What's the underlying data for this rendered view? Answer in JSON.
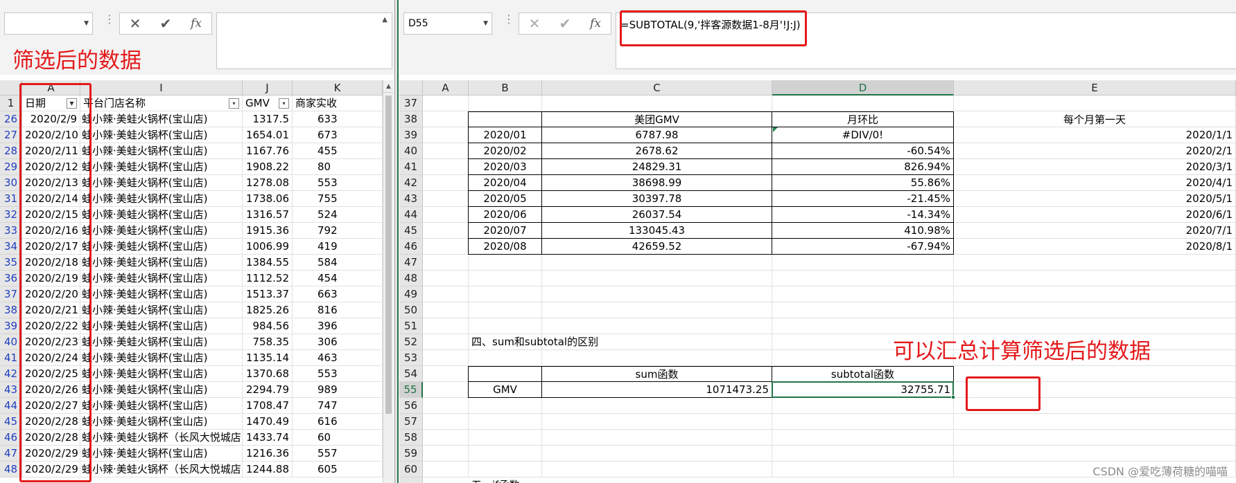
{
  "left": {
    "namebox": "",
    "formula": "",
    "col_headers": [
      "A",
      "I",
      "J",
      "K"
    ],
    "header_row": {
      "row": "1",
      "date": "日期",
      "store": "平台门店名称",
      "gmv": "GMV",
      "merchant": "商家实收"
    },
    "rows": [
      {
        "row": "26",
        "date": "2020/2/9",
        "store": "蛙小辣·美蛙火锅杯(宝山店)",
        "gmv": "1317.5",
        "k": "633"
      },
      {
        "row": "27",
        "date": "2020/2/10",
        "store": "蛙小辣·美蛙火锅杯(宝山店)",
        "gmv": "1654.01",
        "k": "673"
      },
      {
        "row": "28",
        "date": "2020/2/11",
        "store": "蛙小辣·美蛙火锅杯(宝山店)",
        "gmv": "1167.76",
        "k": "455"
      },
      {
        "row": "29",
        "date": "2020/2/12",
        "store": "蛙小辣·美蛙火锅杯(宝山店)",
        "gmv": "1908.22",
        "k": "80"
      },
      {
        "row": "30",
        "date": "2020/2/13",
        "store": "蛙小辣·美蛙火锅杯(宝山店)",
        "gmv": "1278.08",
        "k": "553"
      },
      {
        "row": "31",
        "date": "2020/2/14",
        "store": "蛙小辣·美蛙火锅杯(宝山店)",
        "gmv": "1738.06",
        "k": "755"
      },
      {
        "row": "32",
        "date": "2020/2/15",
        "store": "蛙小辣·美蛙火锅杯(宝山店)",
        "gmv": "1316.57",
        "k": "524"
      },
      {
        "row": "33",
        "date": "2020/2/16",
        "store": "蛙小辣·美蛙火锅杯(宝山店)",
        "gmv": "1915.36",
        "k": "792"
      },
      {
        "row": "34",
        "date": "2020/2/17",
        "store": "蛙小辣·美蛙火锅杯(宝山店)",
        "gmv": "1006.99",
        "k": "419"
      },
      {
        "row": "35",
        "date": "2020/2/18",
        "store": "蛙小辣·美蛙火锅杯(宝山店)",
        "gmv": "1384.55",
        "k": "584"
      },
      {
        "row": "36",
        "date": "2020/2/19",
        "store": "蛙小辣·美蛙火锅杯(宝山店)",
        "gmv": "1112.52",
        "k": "454"
      },
      {
        "row": "37",
        "date": "2020/2/20",
        "store": "蛙小辣·美蛙火锅杯(宝山店)",
        "gmv": "1513.37",
        "k": "663"
      },
      {
        "row": "38",
        "date": "2020/2/21",
        "store": "蛙小辣·美蛙火锅杯(宝山店)",
        "gmv": "1825.26",
        "k": "816"
      },
      {
        "row": "39",
        "date": "2020/2/22",
        "store": "蛙小辣·美蛙火锅杯(宝山店)",
        "gmv": "984.56",
        "k": "396"
      },
      {
        "row": "40",
        "date": "2020/2/23",
        "store": "蛙小辣·美蛙火锅杯(宝山店)",
        "gmv": "758.35",
        "k": "306"
      },
      {
        "row": "41",
        "date": "2020/2/24",
        "store": "蛙小辣·美蛙火锅杯(宝山店)",
        "gmv": "1135.14",
        "k": "463"
      },
      {
        "row": "42",
        "date": "2020/2/25",
        "store": "蛙小辣·美蛙火锅杯(宝山店)",
        "gmv": "1370.68",
        "k": "553"
      },
      {
        "row": "43",
        "date": "2020/2/26",
        "store": "蛙小辣·美蛙火锅杯(宝山店)",
        "gmv": "2294.79",
        "k": "989"
      },
      {
        "row": "44",
        "date": "2020/2/27",
        "store": "蛙小辣·美蛙火锅杯(宝山店)",
        "gmv": "1708.47",
        "k": "747"
      },
      {
        "row": "45",
        "date": "2020/2/28",
        "store": "蛙小辣·美蛙火锅杯(宝山店)",
        "gmv": "1470.49",
        "k": "616"
      },
      {
        "row": "46",
        "date": "2020/2/28",
        "store": "蛙小辣·美蛙火锅杯（长风大悦城店",
        "gmv": "1433.74",
        "k": "60"
      },
      {
        "row": "47",
        "date": "2020/2/29",
        "store": "蛙小辣·美蛙火锅杯(宝山店)",
        "gmv": "1216.36",
        "k": "557"
      },
      {
        "row": "48",
        "date": "2020/2/29",
        "store": "蛙小辣·美蛙火锅杯（长风大悦城店",
        "gmv": "1244.88",
        "k": "605"
      }
    ],
    "annotation": "筛选后的数据"
  },
  "right": {
    "namebox": "D55",
    "formula": "=SUBTOTAL(9,'拌客源数据1-8月'!J:J)",
    "col_headers": [
      "A",
      "B",
      "C",
      "D",
      "E"
    ],
    "row_numbers": [
      "37",
      "38",
      "39",
      "40",
      "41",
      "42",
      "43",
      "44",
      "45",
      "46",
      "47",
      "48",
      "49",
      "50",
      "51",
      "52",
      "53",
      "54",
      "55",
      "56",
      "57",
      "58",
      "59",
      "60"
    ],
    "monthly_table": {
      "headers": [
        "",
        "美团GMV",
        "月环比",
        "每个月第一天"
      ],
      "rows": [
        [
          "2020/01",
          "6787.98",
          "#DIV/0!",
          "2020/1/1"
        ],
        [
          "2020/02",
          "2678.62",
          "-60.54%",
          "2020/2/1"
        ],
        [
          "2020/03",
          "24829.31",
          "826.94%",
          "2020/3/1"
        ],
        [
          "2020/04",
          "38698.99",
          "55.86%",
          "2020/4/1"
        ],
        [
          "2020/05",
          "30397.78",
          "-21.45%",
          "2020/5/1"
        ],
        [
          "2020/06",
          "26037.54",
          "-14.34%",
          "2020/6/1"
        ],
        [
          "2020/07",
          "133045.43",
          "410.98%",
          "2020/7/1"
        ],
        [
          "2020/08",
          "42659.52",
          "-67.94%",
          "2020/8/1"
        ]
      ]
    },
    "section_title": "四、sum和subtotal的区别",
    "compare_table": {
      "headers": [
        "",
        "sum函数",
        "subtotal函数"
      ],
      "row": [
        "GMV",
        "1071473.25",
        "32755.71"
      ]
    },
    "partial_next_section": "五、if函数",
    "annotation": "可以汇总计算筛选后的数据"
  },
  "icons": {
    "cancel": "✕",
    "enter": "✔",
    "fx": "fx"
  },
  "watermark": "CSDN @爱吃薄荷糖的喵喵",
  "colors": {
    "annotation_red": "#e4191b",
    "excel_green": "#217346",
    "filtered_row_blue": "#1f3fbf"
  }
}
